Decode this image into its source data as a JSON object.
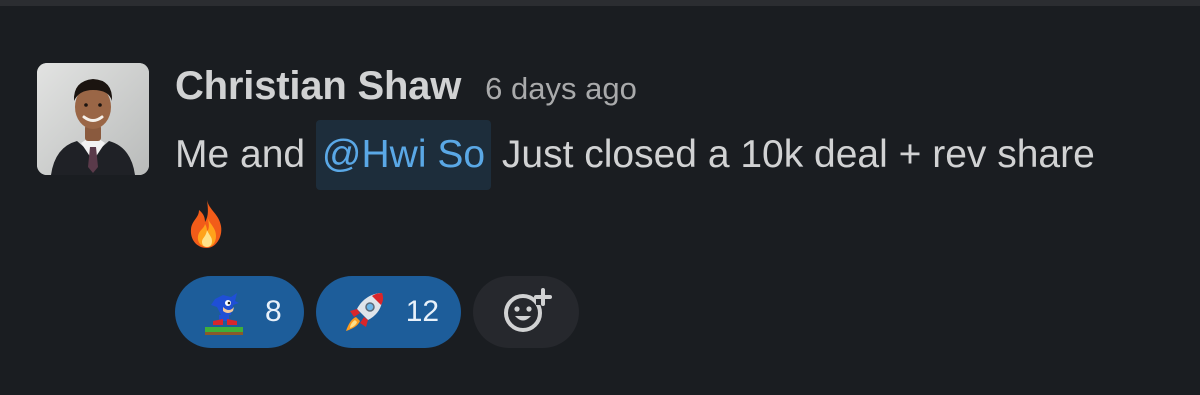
{
  "message": {
    "author": "Christian Shaw",
    "timestamp": "6 days ago",
    "text_before": "Me and ",
    "mention": "@Hwi So",
    "text_after": " Just closed a 10k deal + rev share",
    "inline_emoji": "fire-emoji"
  },
  "reactions": [
    {
      "emoji": "sonic-running-emoji",
      "count": "8"
    },
    {
      "emoji": "rocket-emoji",
      "count": "12"
    }
  ],
  "add_reaction": {
    "icon": "add-reaction-icon"
  },
  "colors": {
    "background": "#1a1d21",
    "mention_text": "#5aa8e6",
    "mention_bg": "#1d2d3b",
    "reaction_bg": "#1d5d9a",
    "add_reaction_bg": "#26282d"
  }
}
